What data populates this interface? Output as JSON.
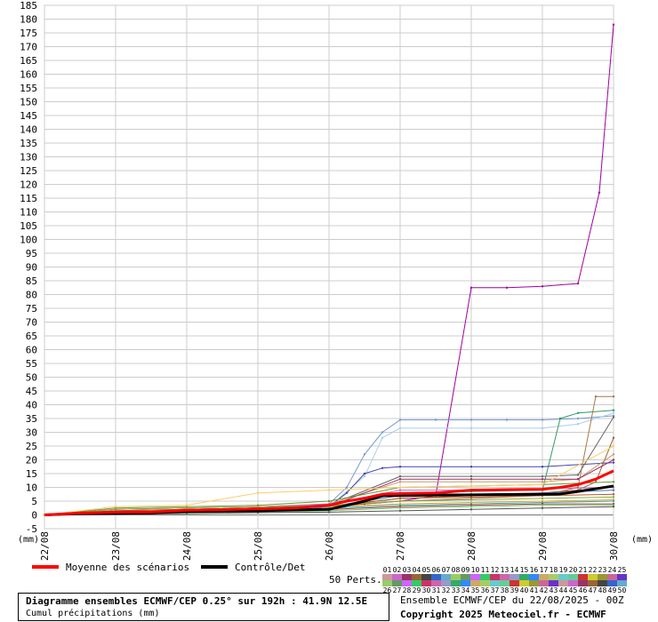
{
  "chart_data": {
    "type": "line",
    "title": "Diagramme ensembles ECMWF/CEP 0.25° sur 192h : 41.9N 12.5E",
    "subtitle": "Cumul précipitations (mm)",
    "ylabel": "(mm)",
    "xlabel": "(mm)",
    "ylim": [
      -5,
      185
    ],
    "yticks": [
      -5,
      0,
      5,
      10,
      15,
      20,
      25,
      30,
      35,
      40,
      45,
      50,
      55,
      60,
      65,
      70,
      75,
      80,
      85,
      90,
      95,
      100,
      105,
      110,
      115,
      120,
      125,
      130,
      135,
      140,
      145,
      150,
      155,
      160,
      165,
      170,
      175,
      180,
      185
    ],
    "xlim": [
      0,
      8
    ],
    "xticks": [
      "22/08",
      "23/08",
      "24/08",
      "25/08",
      "26/08",
      "27/08",
      "28/08",
      "29/08",
      "30/08"
    ],
    "grid": true,
    "legend_placement": "bottom",
    "series": [
      {
        "name": "Moyenne des scénarios",
        "color": "#ff0000",
        "width": 3,
        "x": [
          0,
          0.5,
          1,
          1.5,
          2,
          2.5,
          3,
          3.5,
          4,
          4.25,
          4.5,
          4.75,
          5,
          5.5,
          6,
          6.5,
          7,
          7.25,
          7.5,
          7.75,
          8
        ],
        "y": [
          0,
          0.7,
          1,
          1.1,
          1.7,
          1.9,
          2.2,
          2.5,
          3.5,
          5,
          6,
          7.5,
          7.8,
          8,
          9,
          9.2,
          9.3,
          10,
          11,
          13,
          16
        ]
      },
      {
        "name": "Contrôle/Det",
        "color": "#000000",
        "width": 3,
        "x": [
          0,
          0.5,
          1,
          1.5,
          2,
          2.5,
          3,
          3.5,
          4,
          4.25,
          4.5,
          4.75,
          5,
          5.5,
          6,
          6.5,
          7,
          7.25,
          7.5,
          7.75,
          8
        ],
        "y": [
          0,
          0.5,
          0.6,
          0.7,
          1.3,
          1.4,
          1.5,
          1.8,
          2,
          3.5,
          5,
          7,
          7,
          7.2,
          7.3,
          7.4,
          7.5,
          7.6,
          8.5,
          9.5,
          10.5
        ]
      },
      {
        "name": "",
        "color": "#a000a0",
        "width": 1,
        "x": [
          0,
          0.5,
          1,
          1.5,
          2,
          2.5,
          3,
          3.5,
          4,
          4.5,
          5,
          5.5,
          6,
          6.5,
          7,
          7.5,
          7.8,
          8
        ],
        "y": [
          0,
          1,
          1.2,
          1.3,
          1.5,
          1.8,
          2,
          2.5,
          3,
          4,
          5,
          7,
          82.5,
          82.5,
          83,
          84,
          117,
          178
        ]
      },
      {
        "name": "",
        "color": "#7799cc",
        "width": 1,
        "x": [
          0,
          1,
          2,
          3,
          3.5,
          4,
          4.25,
          4.5,
          4.75,
          5,
          5.5,
          6,
          6.5,
          7,
          7.5,
          8
        ],
        "y": [
          0,
          1,
          1.5,
          2,
          3,
          4,
          10,
          22,
          30,
          34.5,
          34.5,
          34.5,
          34.5,
          34.5,
          35,
          36
        ]
      },
      {
        "name": "",
        "color": "#aaccee",
        "width": 1,
        "x": [
          0,
          1,
          2,
          3,
          4,
          4.5,
          4.75,
          5,
          6,
          7,
          7.5,
          8
        ],
        "y": [
          0,
          1,
          1.5,
          2,
          3,
          14,
          28,
          31.5,
          31.5,
          31.5,
          33,
          37
        ]
      },
      {
        "name": "",
        "color": "#339966",
        "width": 1,
        "x": [
          0,
          1,
          2,
          3,
          4,
          4.5,
          5,
          6,
          7,
          7.25,
          7.5,
          8
        ],
        "y": [
          0,
          1,
          1.3,
          2,
          3,
          5,
          8,
          8.5,
          9,
          35,
          37,
          38
        ]
      },
      {
        "name": "",
        "color": "#4444aa",
        "width": 1,
        "x": [
          0,
          1,
          2,
          3,
          4,
          4.25,
          4.5,
          4.75,
          5,
          6,
          7,
          8
        ],
        "y": [
          0,
          1,
          1.5,
          2,
          3,
          8,
          15,
          17,
          17.5,
          17.5,
          17.5,
          19
        ]
      },
      {
        "name": "",
        "color": "#aa7744",
        "width": 1,
        "x": [
          0,
          1,
          2,
          3,
          4,
          5,
          6,
          7,
          7.5,
          7.75,
          8
        ],
        "y": [
          0,
          1,
          1.5,
          2,
          3,
          5,
          6,
          7,
          10,
          43,
          43
        ]
      },
      {
        "name": "",
        "color": "#666666",
        "width": 1,
        "x": [
          0,
          1,
          2,
          3,
          4,
          5,
          6,
          7,
          7.5,
          8
        ],
        "y": [
          0,
          1.2,
          1.8,
          2.5,
          3.5,
          14,
          14,
          14,
          14.5,
          35.5
        ]
      },
      {
        "name": "",
        "color": "#996633",
        "width": 1,
        "x": [
          0,
          1,
          2,
          3,
          4,
          5,
          6,
          7,
          7.5,
          7.75,
          8
        ],
        "y": [
          0,
          1,
          1.5,
          2,
          3,
          6,
          7,
          8,
          9,
          12,
          28
        ]
      },
      {
        "name": "",
        "color": "#cc9966",
        "width": 1,
        "x": [
          0,
          1,
          2,
          3,
          4,
          5,
          6,
          7,
          7.5,
          8
        ],
        "y": [
          0,
          2,
          2.5,
          3,
          4,
          12,
          12,
          12,
          13,
          22
        ]
      },
      {
        "name": "",
        "color": "#993366",
        "width": 1,
        "x": [
          0,
          1,
          2,
          3,
          4,
          5,
          6,
          7,
          7.5,
          8
        ],
        "y": [
          0,
          1.5,
          2,
          2.5,
          3,
          13,
          13,
          13,
          13,
          20
        ]
      },
      {
        "name": "",
        "color": "#669933",
        "width": 1,
        "x": [
          0,
          1,
          2,
          3,
          4,
          5,
          6,
          7,
          8
        ],
        "y": [
          0,
          2.5,
          3,
          3.5,
          5,
          10,
          10.5,
          11,
          12
        ]
      },
      {
        "name": "",
        "color": "#cc66cc",
        "width": 1,
        "x": [
          0,
          1,
          2,
          3,
          4,
          5,
          6,
          7,
          8
        ],
        "y": [
          0,
          2,
          2.5,
          3,
          4,
          9,
          9,
          9.5,
          10
        ]
      },
      {
        "name": "",
        "color": "#4477aa",
        "width": 1,
        "x": [
          0,
          1,
          2,
          3,
          4,
          5,
          6,
          7,
          8
        ],
        "y": [
          0,
          1,
          1.5,
          2,
          3,
          7,
          7.5,
          8,
          9
        ]
      },
      {
        "name": "",
        "color": "#bb5533",
        "width": 1,
        "x": [
          0,
          1,
          2,
          3,
          4,
          5,
          6,
          7,
          8
        ],
        "y": [
          0,
          1.5,
          2,
          2.5,
          3,
          6,
          6.5,
          7,
          7.5
        ]
      },
      {
        "name": "",
        "color": "#88aa44",
        "width": 1,
        "x": [
          0,
          1,
          2,
          3,
          4,
          5,
          6,
          7,
          8
        ],
        "y": [
          0,
          2,
          2.5,
          3,
          3.5,
          5,
          5.5,
          6,
          6.5
        ]
      },
      {
        "name": "",
        "color": "#ddaa33",
        "width": 1,
        "x": [
          0,
          1,
          2,
          3,
          4,
          5,
          6,
          7,
          8
        ],
        "y": [
          0,
          1,
          2,
          2.5,
          3,
          4,
          4.5,
          5,
          5.5
        ]
      },
      {
        "name": "",
        "color": "#33aaaa",
        "width": 1,
        "x": [
          0,
          1,
          2,
          3,
          4,
          5,
          6,
          7,
          8
        ],
        "y": [
          0,
          1,
          1.5,
          2,
          2.5,
          3.5,
          4,
          4.5,
          5
        ]
      },
      {
        "name": "",
        "color": "#aa3333",
        "width": 1,
        "x": [
          0,
          1,
          2,
          3,
          4,
          5,
          6,
          7,
          8
        ],
        "y": [
          0,
          0.5,
          1,
          1.5,
          2,
          3,
          3.5,
          4,
          4
        ]
      },
      {
        "name": "",
        "color": "#77cc77",
        "width": 1,
        "x": [
          0,
          1,
          2,
          3,
          4,
          5,
          6,
          7,
          8
        ],
        "y": [
          0,
          0.5,
          0.8,
          1,
          1.5,
          2.5,
          3,
          3.5,
          3.5
        ]
      },
      {
        "name": "",
        "color": "#555555",
        "width": 1,
        "x": [
          0,
          1,
          2,
          3,
          4,
          5,
          6,
          7,
          8
        ],
        "y": [
          0,
          0.3,
          0.5,
          0.8,
          1,
          1.5,
          2,
          2.5,
          3
        ]
      },
      {
        "name": "",
        "color": "#ffcc66",
        "width": 1,
        "x": [
          0,
          1,
          2,
          3,
          4,
          5,
          6,
          7,
          8
        ],
        "y": [
          0,
          3,
          3.5,
          8,
          9,
          10,
          10.5,
          11,
          25
        ]
      }
    ]
  },
  "legend": {
    "mean_label": "Moyenne des scénarios",
    "control_label": "Contrôle/Det",
    "perts_label": "50 Perts.",
    "mean_color": "#ff0000",
    "control_color": "#000000"
  },
  "perts": {
    "top_numbers": [
      "01",
      "02",
      "03",
      "04",
      "05",
      "06",
      "07",
      "08",
      "09",
      "10",
      "11",
      "12",
      "13",
      "14",
      "15",
      "16",
      "17",
      "18",
      "19",
      "20",
      "21",
      "22",
      "23",
      "24",
      "25"
    ],
    "bottom_numbers": [
      "26",
      "27",
      "28",
      "29",
      "30",
      "31",
      "32",
      "33",
      "34",
      "35",
      "36",
      "37",
      "38",
      "39",
      "40",
      "41",
      "42",
      "43",
      "44",
      "45",
      "46",
      "47",
      "48",
      "49",
      "50"
    ],
    "colors": [
      "#cc9999",
      "#cc66cc",
      "#993366",
      "#996633",
      "#444444",
      "#3366cc",
      "#66aacc",
      "#99cc66",
      "#669966",
      "#cc66ff",
      "#33cc66",
      "#cc3366",
      "#cc66aa",
      "#9999cc",
      "#33aa66",
      "#3388ff",
      "#ccaa66",
      "#aacc66",
      "#66cccc",
      "#66cc99",
      "#cc3333",
      "#cccc33",
      "#999933",
      "#cc6699",
      "#6633cc"
    ]
  },
  "title_box": {
    "main": "Diagramme ensembles ECMWF/CEP 0.25° sur 192h : 41.9N 12.5E",
    "sub": "Cumul précipitations (mm)"
  },
  "info": {
    "run": "Ensemble ECMWF/CEP du 22/08/2025 - 00Z",
    "copyright": "Copyright 2025 Meteociel.fr - ECMWF"
  }
}
